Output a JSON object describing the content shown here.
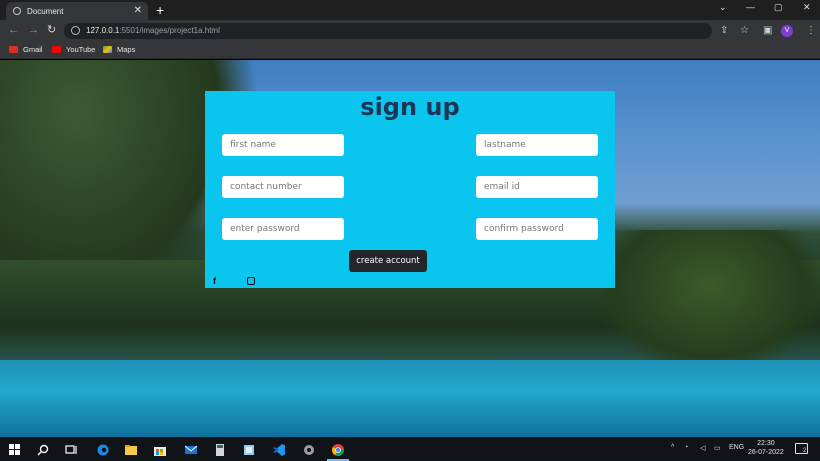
{
  "browser": {
    "tab_title": "Document",
    "url_host": "127.0.0.1",
    "url_rest": ":5501/images/project1a.html",
    "profile_initial": "V",
    "bookmarks": [
      {
        "label": "Gmail",
        "color": "#d93025"
      },
      {
        "label": "YouTube",
        "color": "#ff0000"
      },
      {
        "label": "Maps",
        "color": "#34a853"
      }
    ]
  },
  "form": {
    "title": "sign up",
    "first_name_placeholder": "first name",
    "last_name_placeholder": "lastname",
    "contact_placeholder": "contact number",
    "email_placeholder": "email id",
    "password_placeholder": "enter password",
    "confirm_placeholder": "confirm password",
    "submit_label": "create account",
    "social": [
      {
        "name": "facebook-icon",
        "glyph": "f"
      },
      {
        "name": "instagram-icon"
      }
    ]
  },
  "taskbar": {
    "tray_lang": "ENG",
    "time": "22:30",
    "date": "26-07-2022",
    "notification_count": "2"
  },
  "colors": {
    "card_bg": "#0ac6ef",
    "title_color": "#1d3557",
    "button_bg": "#23272b"
  }
}
